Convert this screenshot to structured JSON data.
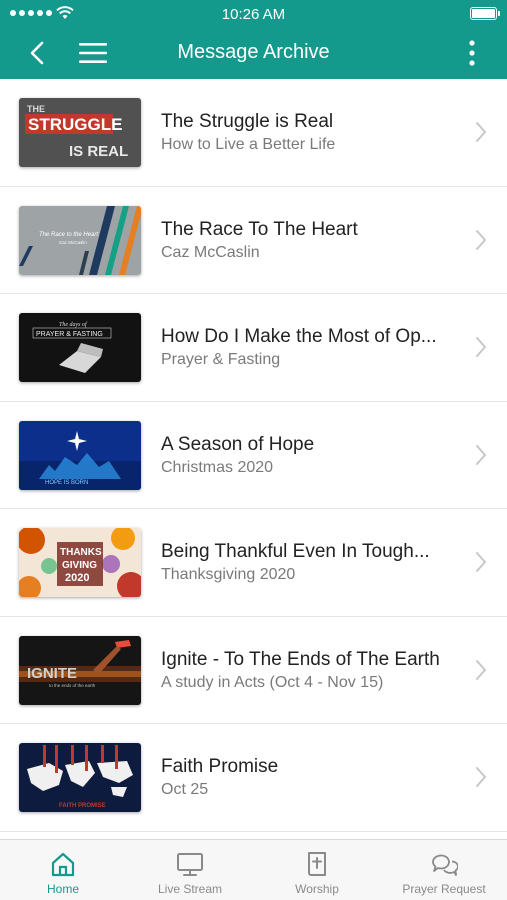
{
  "status": {
    "time": "10:26 AM"
  },
  "nav": {
    "title": "Message Archive"
  },
  "items": [
    {
      "title": "The Struggle is Real",
      "subtitle": "How to Live a Better Life",
      "thumb_text": [
        "THE",
        "STRUGGLE",
        "IS REAL"
      ]
    },
    {
      "title": "The Race To The Heart",
      "subtitle": "Caz McCaslin",
      "thumb_text": [
        "The Race to the Heart",
        "Caz McCaslin"
      ]
    },
    {
      "title": "How Do I Make the Most of Op...",
      "subtitle": "Prayer & Fasting",
      "thumb_text": [
        "The days of",
        "PRAYER & FASTING"
      ]
    },
    {
      "title": "A Season of Hope",
      "subtitle": "Christmas 2020",
      "thumb_text": [
        "HOPE IS BORN"
      ]
    },
    {
      "title": "Being Thankful Even In Tough...",
      "subtitle": "Thanksgiving 2020",
      "thumb_text": [
        "THANKS",
        "GIVING",
        "2020"
      ]
    },
    {
      "title": "Ignite - To The Ends of The Earth",
      "subtitle": "A study in Acts (Oct 4 - Nov 15)",
      "thumb_text": [
        "IGNITE",
        "to the ends of the earth"
      ]
    },
    {
      "title": "Faith Promise",
      "subtitle": "Oct 25",
      "thumb_text": [
        "FAITH PROMISE"
      ]
    }
  ],
  "tabs": [
    {
      "label": "Home",
      "icon": "home-icon",
      "active": true
    },
    {
      "label": "Live Stream",
      "icon": "tv-icon",
      "active": false
    },
    {
      "label": "Worship",
      "icon": "bible-icon",
      "active": false
    },
    {
      "label": "Prayer Request",
      "icon": "chat-bubbles-icon",
      "active": false
    }
  ],
  "colors": {
    "accent": "#139a8d",
    "tab_inactive": "#8a8a8a",
    "divider": "#e6e6e6"
  }
}
